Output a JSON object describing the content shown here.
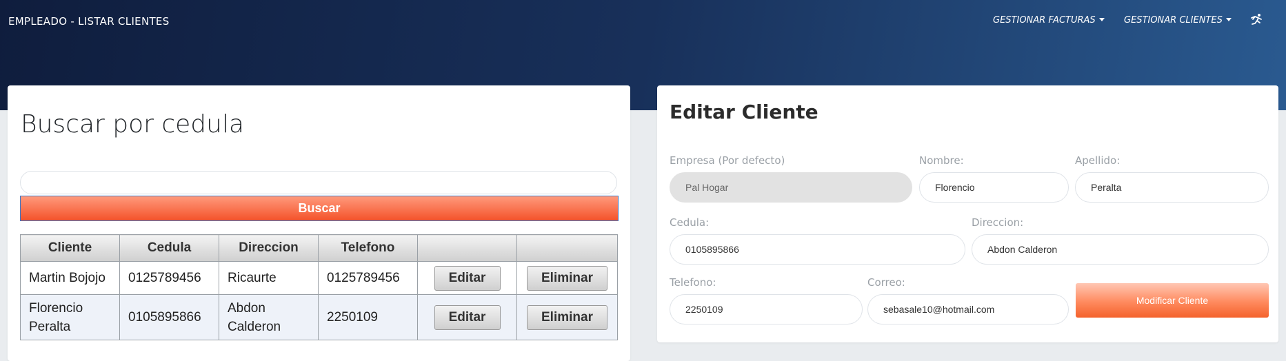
{
  "header": {
    "title": "EMPLEADO - LISTAR CLIENTES",
    "nav": [
      {
        "label": "GESTIONAR FACTURAS"
      },
      {
        "label": "GESTIONAR CLIENTES"
      }
    ],
    "logout_icon": "runner-icon"
  },
  "search_panel": {
    "heading": "Buscar por cedula",
    "input_value": "",
    "button_label": "Buscar",
    "table": {
      "columns": [
        "Cliente",
        "Cedula",
        "Direccion",
        "Telefono",
        "",
        ""
      ],
      "rows": [
        {
          "cliente": "Martin Bojojo",
          "cedula": "0125789456",
          "direccion": "Ricaurte",
          "telefono": "0125789456",
          "edit_label": "Editar",
          "delete_label": "Eliminar"
        },
        {
          "cliente": "Florencio Peralta",
          "cedula": "0105895866",
          "direccion": "Abdon Calderon",
          "telefono": "2250109",
          "edit_label": "Editar",
          "delete_label": "Eliminar"
        }
      ]
    }
  },
  "edit_panel": {
    "heading": "Editar Cliente",
    "empresa_label": "Empresa (Por defecto)",
    "empresa_value": "Pal Hogar",
    "nombre_label": "Nombre:",
    "nombre_value": "Florencio",
    "apellido_label": "Apellido:",
    "apellido_value": "Peralta",
    "cedula_label": "Cedula:",
    "cedula_value": "0105895866",
    "direccion_label": "Direccion:",
    "direccion_value": "Abdon Calderon",
    "telefono_label": "Telefono:",
    "telefono_value": "2250109",
    "correo_label": "Correo:",
    "correo_value": "sebasale10@hotmail.com",
    "submit_label": "Modificar Cliente"
  },
  "colors": {
    "accent_orange": "#f4522a",
    "header_dark": "#0f1d3d",
    "header_light": "#2a5a90"
  }
}
